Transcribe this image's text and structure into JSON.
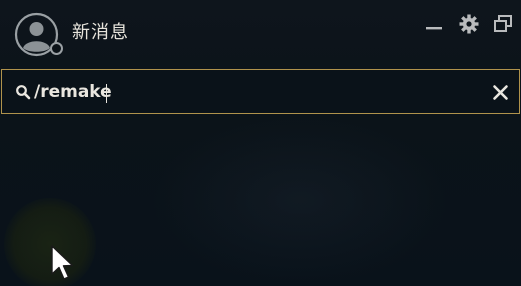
{
  "window": {
    "title": "新消息"
  },
  "search": {
    "value": "/remake",
    "placeholder": ""
  },
  "icons": {
    "avatar": "user-avatar-icon",
    "status": "status-dot-icon",
    "minimize": "minimize-icon",
    "settings": "gear-icon",
    "popout": "popout-window-icon",
    "search": "search-icon",
    "clear": "close-icon",
    "cursor": "mouse-pointer-icon"
  },
  "colors": {
    "background": "#0b1218",
    "accent_border": "#b0934c",
    "text": "#e7e4dc",
    "icon": "#b9bbbd"
  }
}
